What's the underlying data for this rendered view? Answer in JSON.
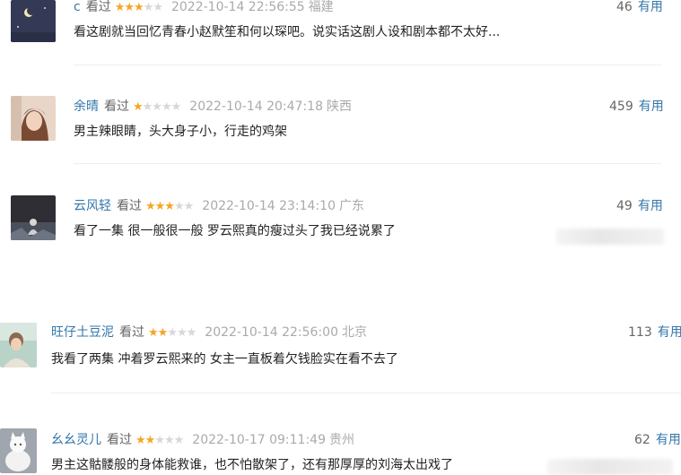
{
  "reviews": [
    {
      "user": "c",
      "watched": "看过",
      "stars_filled": 3,
      "stars_total": 5,
      "time": "2022-10-14 22:56:55",
      "location": "福建",
      "votes": "46",
      "useful_label": "有用",
      "comment": "看这剧就当回忆青春小赵默笙和何以琛吧。说实话这剧人设和剧本都不太好..."
    },
    {
      "user": "余晴",
      "watched": "看过",
      "stars_filled": 1,
      "stars_total": 5,
      "time": "2022-10-14 20:47:18",
      "location": "陕西",
      "votes": "459",
      "useful_label": "有用",
      "comment": "男主辣眼睛，头大身子小，行走的鸡架"
    },
    {
      "user": "云风轻",
      "watched": "看过",
      "stars_filled": 3,
      "stars_total": 5,
      "time": "2022-10-14 23:14:10",
      "location": "广东",
      "votes": "49",
      "useful_label": "有用",
      "comment": "看了一集 很一般很一般 罗云熙真的瘦过头了我已经说累了"
    },
    {
      "user": "旺仔土豆泥",
      "watched": "看过",
      "stars_filled": 2,
      "stars_total": 5,
      "time": "2022-10-14 22:56:00",
      "location": "北京",
      "votes": "113",
      "useful_label": "有用",
      "comment": "我看了两集 冲着罗云熙来的 女主一直板着欠钱脸实在看不去了"
    },
    {
      "user": "幺幺灵儿",
      "watched": "看过",
      "stars_filled": 2,
      "stars_total": 5,
      "time": "2022-10-17 09:11:49",
      "location": "贵州",
      "votes": "62",
      "useful_label": "有用",
      "comment": "男主这骷髅般的身体能救谁，也不怕散架了，还有那厚厚的刘海太出戏了"
    }
  ],
  "colors": {
    "username": "#3377aa",
    "star_on": "#f5a623",
    "star_off": "#d7d7d7",
    "muted": "#aaaaaa"
  }
}
